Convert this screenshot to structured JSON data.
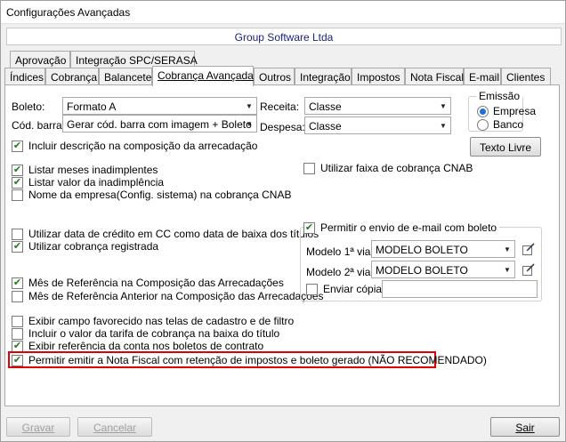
{
  "window": {
    "title": "Configurações Avançadas"
  },
  "company": "Group Software Ltda",
  "tabs_top": [
    {
      "label": "Aprovação"
    },
    {
      "label": "Integração SPC/SERASA"
    }
  ],
  "tabs": [
    {
      "label": "Índices"
    },
    {
      "label": "Cobrança"
    },
    {
      "label": "Balancete"
    },
    {
      "label": "Cobrança Avançada",
      "active": true
    },
    {
      "label": "Outros"
    },
    {
      "label": "Integração"
    },
    {
      "label": "Impostos"
    },
    {
      "label": "Nota Fiscal"
    },
    {
      "label": "E-mail"
    },
    {
      "label": "Clientes"
    }
  ],
  "form": {
    "boleto_label": "Boleto:",
    "boleto_value": "Formato A",
    "codbarra_label": "Cód. barra:",
    "codbarra_value": "Gerar cód. barra com imagem + Boleto",
    "receita_label": "Receita:",
    "receita_value": "Classe",
    "despesa_label": "Despesa:",
    "despesa_value": "Classe"
  },
  "emissao": {
    "legend": "Emissão",
    "options": [
      {
        "label": "Empresa",
        "selected": true
      },
      {
        "label": "Banco",
        "selected": false
      }
    ]
  },
  "texto_livre_button": "Texto Livre",
  "checks": {
    "incluir_descricao": {
      "label": "Incluir descrição na composição da arrecadação",
      "checked": true
    },
    "listar_meses": {
      "label": "Listar meses inadimplentes",
      "checked": true
    },
    "listar_valor": {
      "label": "Listar valor da inadimplência",
      "checked": true
    },
    "nome_empresa": {
      "label": "Nome da empresa(Config. sistema)  na cobrança CNAB",
      "checked": false
    },
    "faixa_cnab": {
      "label": "Utilizar faixa de cobrança CNAB",
      "checked": false
    },
    "data_credito": {
      "label": "Utilizar data de crédito em CC como data de baixa dos títulos",
      "checked": false
    },
    "cobranca_registrada": {
      "label": "Utilizar cobrança registrada",
      "checked": true
    },
    "mes_referencia": {
      "label": "Mês de Referência na Composição das Arrecadações",
      "checked": true
    },
    "mes_referencia_anterior": {
      "label": "Mês de Referência Anterior na Composição das Arrecadações",
      "checked": false
    },
    "exibir_favorecido": {
      "label": "Exibir campo favorecido nas telas de cadastro e de filtro",
      "checked": false
    },
    "incluir_tarifa": {
      "label": "Incluir o valor da tarifa de cobrança na baixa do título",
      "checked": false
    },
    "exibir_referencia": {
      "label": "Exibir referência da conta nos boletos de contrato",
      "checked": true
    },
    "permitir_nota": {
      "label": "Permitir emitir a Nota Fiscal  com retenção de impostos e boleto gerado (NÃO RECOMENDADO)",
      "checked": true
    }
  },
  "email_group": {
    "legend": "Permitir o envio de e-mail com boleto",
    "checked": true,
    "modelo1_label": "Modelo 1ª via:",
    "modelo1_value": "MODELO BOLETO",
    "modelo2_label": "Modelo 2ª via:",
    "modelo2_value": "MODELO BOLETO",
    "enviar_copia_label": "Enviar cópia:",
    "enviar_copia_checked": false,
    "enviar_copia_value": ""
  },
  "footer": {
    "gravar": "Gravar",
    "cancelar": "Cancelar",
    "sair": "Sair"
  },
  "colors": {
    "highlight": "#e00000",
    "check": "#1d7a1d",
    "company_text": "#1a237e"
  }
}
